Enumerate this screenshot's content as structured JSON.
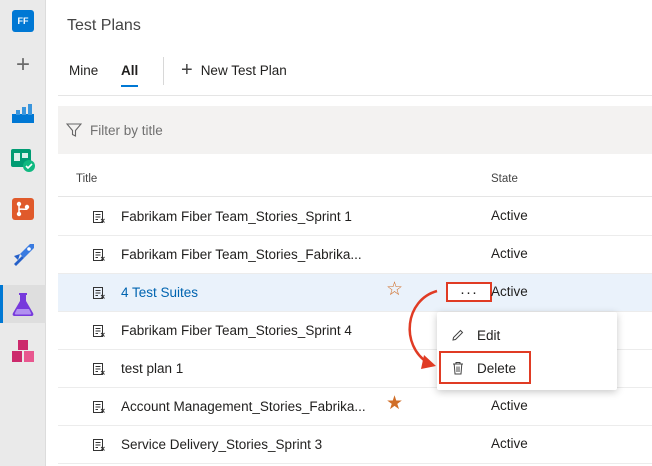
{
  "rail": {
    "org_initials": "FF",
    "items": [
      {
        "name": "org-badge"
      },
      {
        "name": "add-icon"
      },
      {
        "name": "overview-icon",
        "color": "#0078d4"
      },
      {
        "name": "boards-icon",
        "color": "#009c73"
      },
      {
        "name": "repos-icon",
        "color": "#e05a2b"
      },
      {
        "name": "pipelines-icon",
        "color": "#2560c9"
      },
      {
        "name": "test-plans-icon",
        "color": "#773adc"
      },
      {
        "name": "artifacts-icon",
        "color": "#cc2a6c"
      }
    ],
    "selected_index": 6
  },
  "header": {
    "title": "Test Plans"
  },
  "tabs": [
    {
      "label": "Mine",
      "active": false
    },
    {
      "label": "All",
      "active": true
    }
  ],
  "toolbar": {
    "new_plan_label": "New Test Plan"
  },
  "filter": {
    "placeholder": "Filter by title",
    "value": ""
  },
  "table": {
    "columns": [
      "Title",
      "State"
    ],
    "rows": [
      {
        "title": "Fabrikam Fiber Team_Stories_Sprint 1",
        "state": "Active",
        "favorite": "none",
        "highlighted": false
      },
      {
        "title": "Fabrikam Fiber Team_Stories_Fabrika...",
        "state": "Active",
        "favorite": "none",
        "highlighted": false
      },
      {
        "title": "4 Test Suites",
        "state": "Active",
        "favorite": "hollow",
        "highlighted": true
      },
      {
        "title": "Fabrikam Fiber Team_Stories_Sprint 4",
        "state": "",
        "favorite": "none",
        "highlighted": false
      },
      {
        "title": "test plan 1",
        "state": "",
        "favorite": "none",
        "highlighted": false
      },
      {
        "title": "Account Management_Stories_Fabrika...",
        "state": "Active",
        "favorite": "filled",
        "highlighted": false
      },
      {
        "title": "Service Delivery_Stories_Sprint 3",
        "state": "Active",
        "favorite": "none",
        "highlighted": false
      }
    ]
  },
  "more_actions_label": "···",
  "context_menu": {
    "items": [
      {
        "label": "Edit",
        "icon": "pencil-icon"
      },
      {
        "label": "Delete",
        "icon": "trash-icon"
      }
    ]
  },
  "colors": {
    "accent": "#0078d4",
    "annotation": "#e03b24",
    "star": "#d06e28",
    "link": "#0064b0"
  }
}
